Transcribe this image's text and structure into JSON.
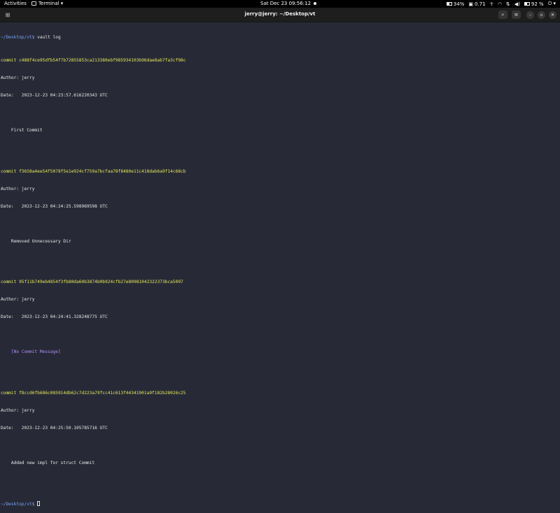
{
  "topbar": {
    "activities": "Activities",
    "app_name": "Terminal ▾",
    "clock": "Sat Dec 23  09:56:12",
    "battery_indicator": "34%",
    "load_indicator": "0.71",
    "volume_percent": "92 %",
    "power_glyph": "⏻ ▾"
  },
  "window": {
    "title": "jerry@jerry: ~/Desktop/vt",
    "new_tab_glyph": "⊞",
    "search_glyph": "⌕",
    "menu_glyph": "≡",
    "minimize_glyph": "–",
    "maximize_glyph": "▫",
    "close_glyph": "✕"
  },
  "terminal": {
    "prompt": "~/Desktop/vt$",
    "command": " vault log",
    "commits": [
      {
        "commit_line": "commit c488f4ce95dfb54f7b72855853ca213380ebf985934103b96dae8ab7fa3cf98c",
        "author": "Author: jerry",
        "date": "Date:   2023-12-23 04:23:57.616220343 UTC",
        "message": "    First Commit",
        "no_message": false
      },
      {
        "commit_line": "commit f3658a4ee54f5078f5e1e924cf759a7bcfaa78f8480e11c418dab6a9f14c68cb",
        "author": "Author: jerry",
        "date": "Date:   2023-12-23 04:24:25.598969598 UTC",
        "message": "    Removed Unnecessary Dir",
        "no_message": false
      },
      {
        "commit_line": "commit 95f11b749eb4854f3fb80da60b3874b0b924cfb27e80981042322373bca5097",
        "author": "Author: jerry",
        "date": "Date:   2023-12-23 04:24:41.328248775 UTC",
        "message": "    [No Commit Message]",
        "no_message": true
      },
      {
        "commit_line": "commit f8ccd6fb686c085914db62c7d223a79fcc41c613f44341901a9f182b28026c25",
        "author": "Author: jerry",
        "date": "Date:   2023-12-23 04:25:50.105785716 UTC",
        "message": "    Added new impl for struct Commit",
        "no_message": false
      }
    ],
    "final_prompt": "~/Desktop/vt$"
  }
}
